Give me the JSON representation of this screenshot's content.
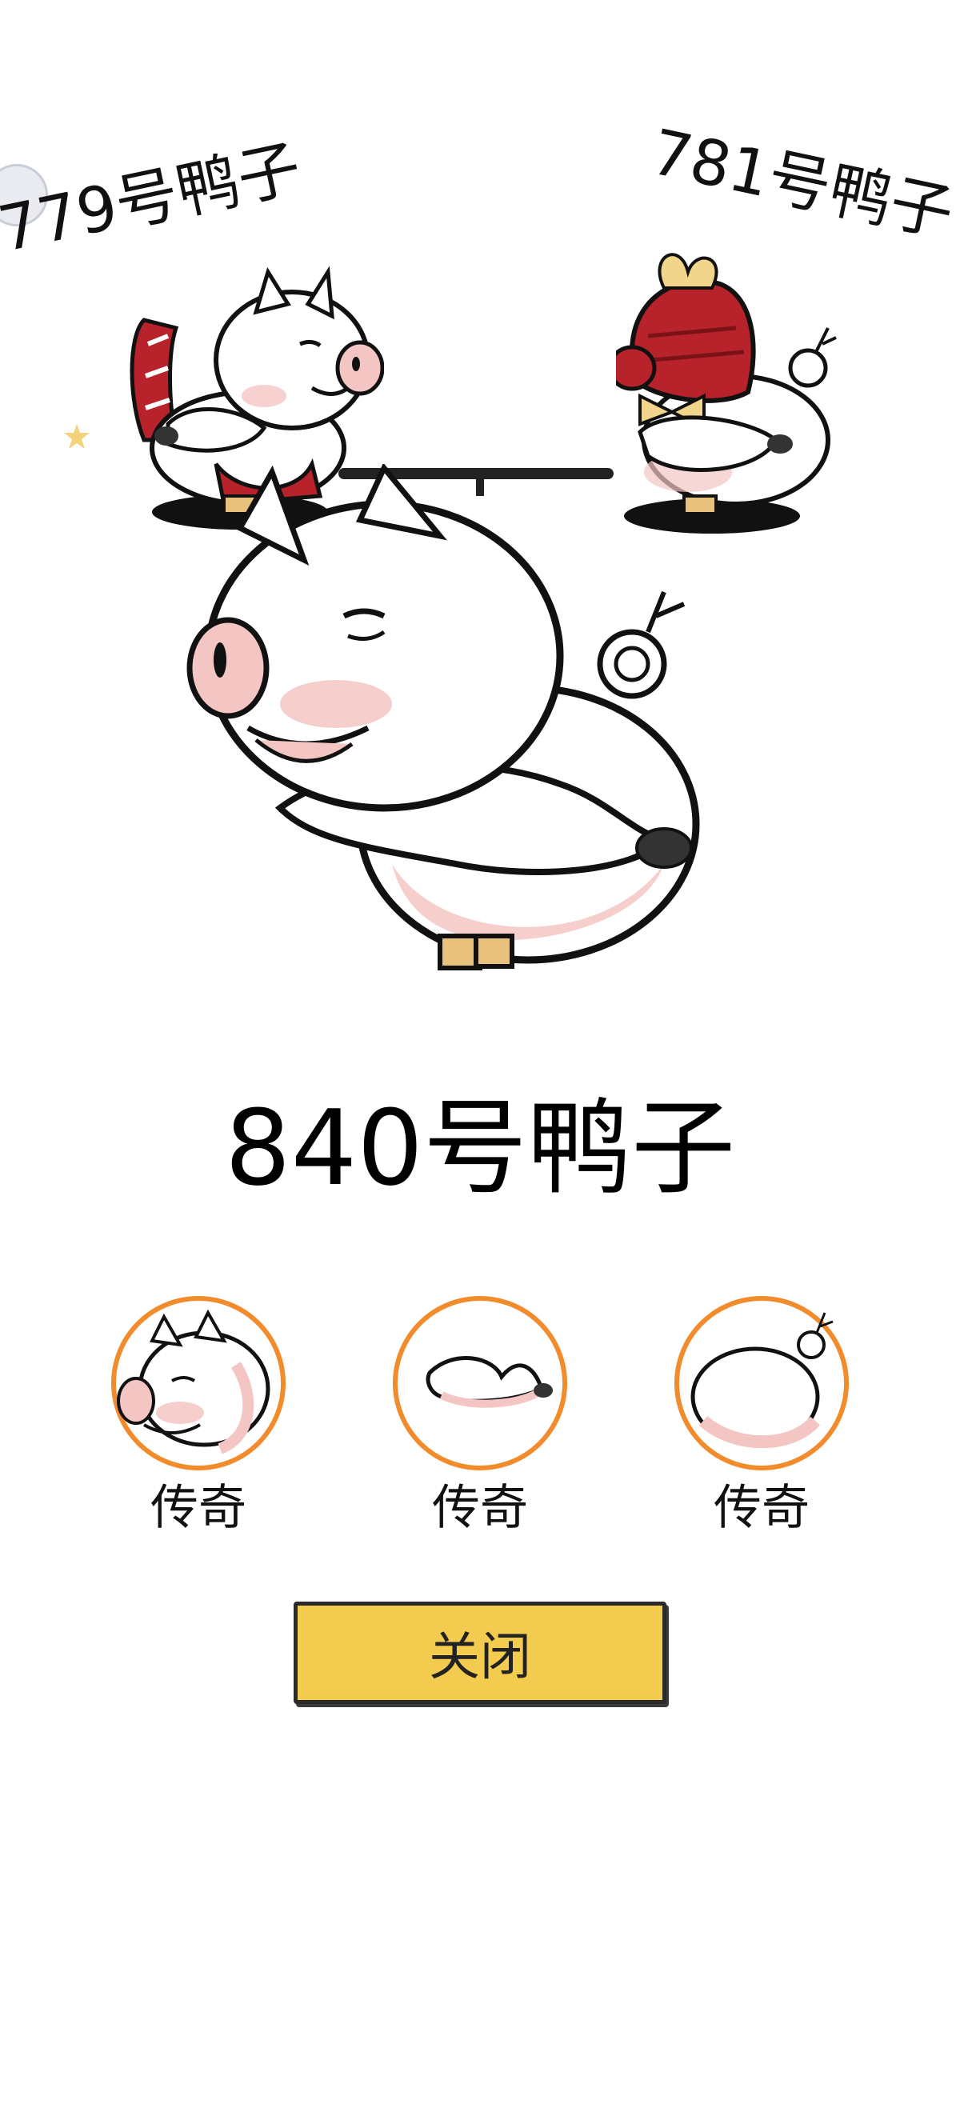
{
  "neighbors": {
    "left_name": "779号鸭子",
    "right_name": "781号鸭子"
  },
  "current": {
    "name": "840号鸭子"
  },
  "parts": [
    {
      "label": "传奇",
      "icon": "pig-head-icon"
    },
    {
      "label": "传奇",
      "icon": "pig-arms-icon"
    },
    {
      "label": "传奇",
      "icon": "pig-body-icon"
    }
  ],
  "actions": {
    "close_label": "关闭"
  },
  "colors": {
    "ring": "#f28b2c",
    "button": "#f2cb4f",
    "pig_pink": "#f4c6c3",
    "armor_red": "#b8222a"
  }
}
